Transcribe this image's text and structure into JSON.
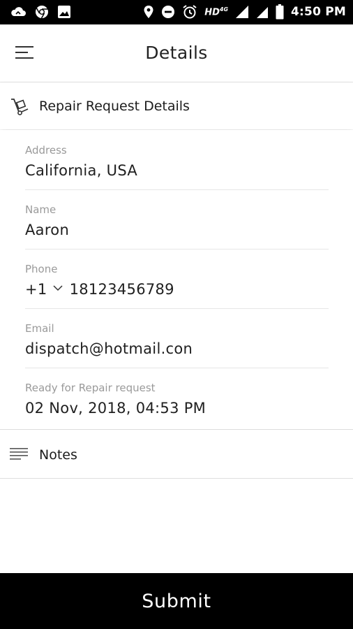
{
  "status_bar": {
    "network": "HD",
    "network_badge": "4G",
    "time": "4:50 PM",
    "icons": [
      "cloud-icon",
      "chrome-icon",
      "image-icon",
      "location-icon",
      "dnd-icon",
      "alarm-icon",
      "signal-icon",
      "signal-icon",
      "battery-icon"
    ]
  },
  "header": {
    "title": "Details",
    "menu_icon": "menu-icon"
  },
  "section": {
    "title": "Repair Request Details",
    "icon": "hand-truck-icon"
  },
  "fields": [
    {
      "label": "Address",
      "value": "California, USA"
    },
    {
      "label": "Name",
      "value": "Aaron"
    },
    {
      "label": "Phone",
      "country_code": "+1",
      "value": "18123456789"
    },
    {
      "label": "Email",
      "value": "dispatch@hotmail.con"
    },
    {
      "label": "Ready for Repair request",
      "value": "02 Nov, 2018, 04:53 PM"
    }
  ],
  "notes": {
    "label": "Notes",
    "icon": "notes-lines-icon"
  },
  "submit": {
    "label": "Submit"
  },
  "colors": {
    "primary": "#000000",
    "background": "#ffffff",
    "label": "#9a9a9a",
    "text": "#1f1f1f"
  }
}
